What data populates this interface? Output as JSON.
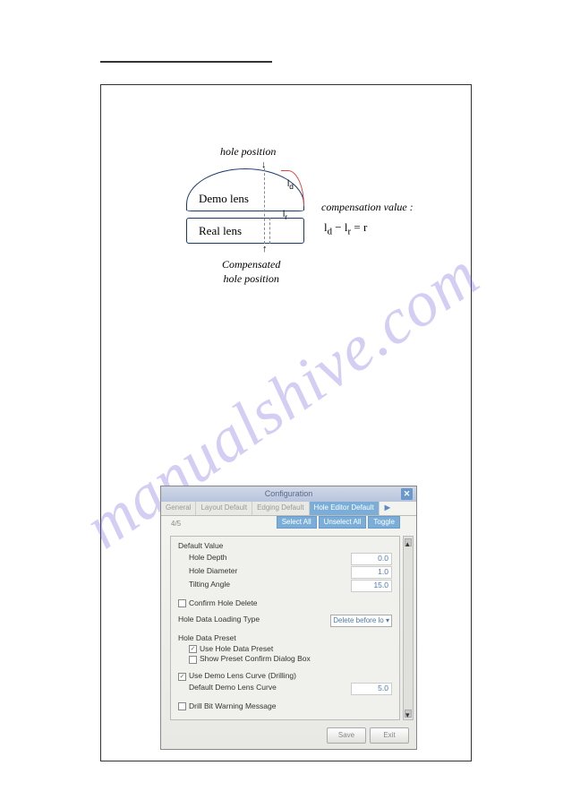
{
  "diagram": {
    "hole_position": "hole position",
    "demo_lens": "Demo lens",
    "real_lens": "Real lens",
    "compensated": "Compensated\nhole position",
    "ld": "l",
    "ld_sub": "d",
    "lr": "l",
    "lr_sub": "r",
    "comp_value_label": "compensation value :",
    "formula_ld": "l",
    "formula_ld_sub": "d",
    "formula_minus": " − ",
    "formula_lr": "l",
    "formula_lr_sub": "r",
    "formula_eq": "  =  r"
  },
  "dialog": {
    "title": "Configuration",
    "tabs": [
      "General",
      "Layout Default",
      "Edging Default",
      "Hole Editor Default"
    ],
    "page": "4/5",
    "sub_buttons": [
      "Select All",
      "Unselect All",
      "Toggle"
    ],
    "sections": {
      "default_value": {
        "heading": "Default Value",
        "hole_depth": "Hole Depth",
        "hole_depth_val": "0.0",
        "hole_diameter": "Hole Diameter",
        "hole_diameter_val": "1.0",
        "tilting_angle": "Tilting Angle",
        "tilting_angle_val": "15.0"
      },
      "confirm_delete": "Confirm Hole Delete",
      "loading_type": {
        "label": "Hole Data Loading Type",
        "value": "Delete before lo"
      },
      "preset": {
        "heading": "Hole Data Preset",
        "use_preset": "Use Hole Data Preset",
        "show_confirm": "Show Preset Confirm Dialog Box"
      },
      "demo_curve": {
        "use": "Use Demo Lens Curve (Drilling)",
        "default_label": "Default Demo Lens Curve",
        "default_val": "5.0"
      },
      "drill_warning": "Drill Bit Warning Message"
    },
    "buttons": {
      "save": "Save",
      "exit": "Exit"
    }
  }
}
